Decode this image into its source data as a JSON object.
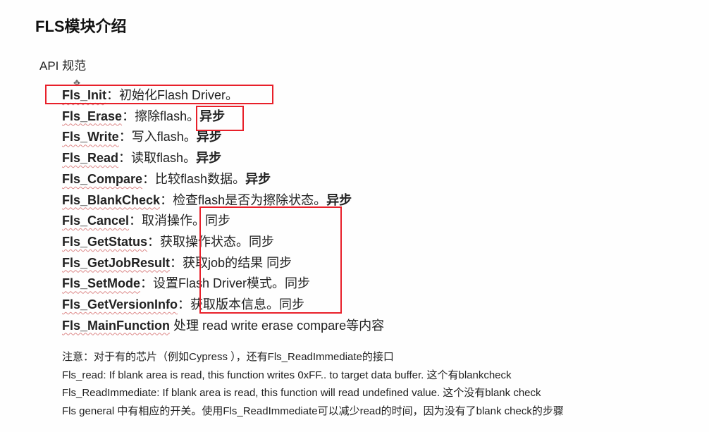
{
  "title": "FLS模块介绍",
  "subtitle": "API 规范",
  "apis": [
    {
      "name": "Fls_Init",
      "sep": "：",
      "desc": "初始化Flash Driver。",
      "mode": ""
    },
    {
      "name": "Fls_Erase",
      "sep": "：",
      "desc": "擦除flash。",
      "mode": "异步"
    },
    {
      "name": "Fls_Write",
      "sep": "：",
      "desc": "写入flash。",
      "mode": "异步"
    },
    {
      "name": "Fls_Read",
      "sep": "：",
      "desc": "读取flash。",
      "mode": "异步"
    },
    {
      "name": "Fls_Compare",
      "sep": "：",
      "desc": "比较flash数据。",
      "mode": "异步"
    },
    {
      "name": "Fls_BlankCheck",
      "sep": "：",
      "desc": "检查flash是否为擦除状态。",
      "mode": "异步"
    },
    {
      "name": "Fls_Cancel",
      "sep": "：",
      "desc": "取消操作。",
      "mode": "同步"
    },
    {
      "name": "Fls_GetStatus",
      "sep": "：",
      "desc": "获取操作状态。",
      "mode": "同步"
    },
    {
      "name": "Fls_GetJobResult",
      "sep": "：",
      "desc": "获取job的结果 ",
      "mode": "同步"
    },
    {
      "name": "Fls_SetMode",
      "sep": "：",
      "desc": "设置Flash Driver模式。",
      "mode": "同步"
    },
    {
      "name": "Fls_GetVersionInfo",
      "sep": "：",
      "desc": "获取版本信息。",
      "mode": "同步"
    },
    {
      "name": "Fls_MainFunction",
      "sep": " ",
      "desc": "处理 read write erase compare等内容",
      "mode": ""
    }
  ],
  "notes": [
    "注意：对于有的芯片（例如Cypress ），还有Fls_ReadImmediate的接口",
    "Fls_read:  If blank area is read, this function writes 0xFF.. to target data buffer.     这个有blankcheck",
    "Fls_ReadImmediate:  If blank area is read, this function will read undefined value.       这个没有blank check",
    "Fls general 中有相应的开关。使用Fls_ReadImmediate可以减少read的时间，因为没有了blank check的步骤"
  ],
  "colors": {
    "highlight_box": "#e8202a"
  }
}
